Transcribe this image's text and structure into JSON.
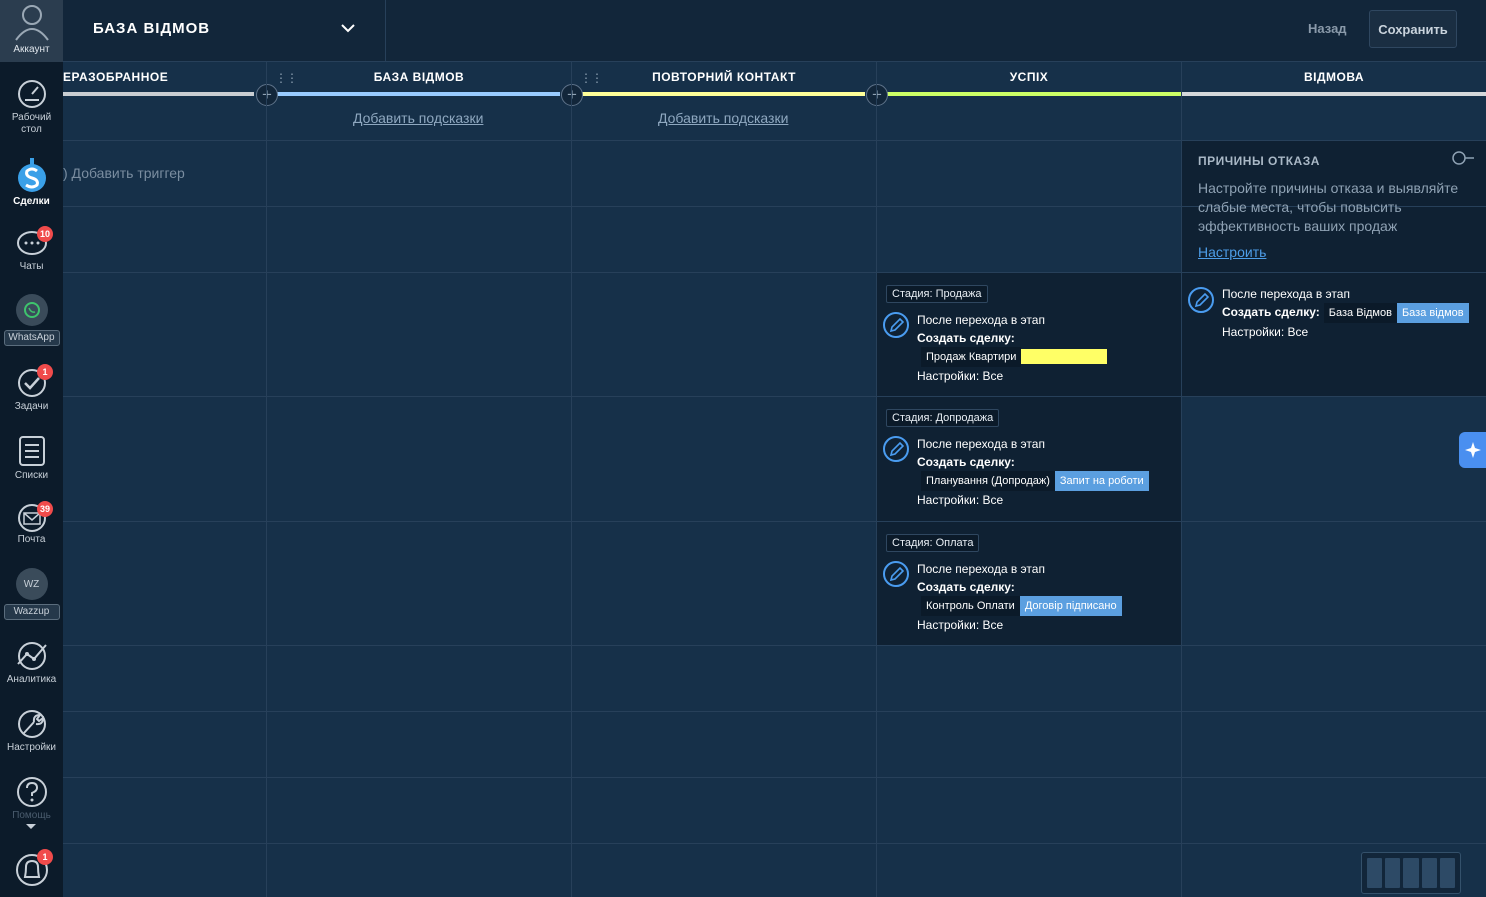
{
  "sidebar": {
    "account_label": "Аккаунт",
    "items": [
      {
        "label": "Рабочий\nстол",
        "icon": "dashboard-icon"
      },
      {
        "label": "Сделки",
        "icon": "deals-icon"
      },
      {
        "label": "Чаты",
        "icon": "chat-icon",
        "badge": "10"
      },
      {
        "label": "WhatsApp",
        "icon": "whatsapp-icon"
      },
      {
        "label": "Задачи",
        "icon": "tasks-icon",
        "badge": "1"
      },
      {
        "label": "Списки",
        "icon": "lists-icon"
      },
      {
        "label": "Почта",
        "icon": "mail-icon",
        "badge": "39"
      },
      {
        "label": "Wazzup",
        "icon": "wazzup-icon",
        "icon_text": "WZ"
      },
      {
        "label": "Аналитика",
        "icon": "analytics-icon"
      },
      {
        "label": "Настройки",
        "icon": "settings-icon"
      },
      {
        "label": "Помощь",
        "icon": "help-icon"
      },
      {
        "label": "",
        "icon": "notifications-icon",
        "badge": "1"
      }
    ]
  },
  "header": {
    "pipeline_title": "БАЗА ВІДМОВ",
    "back_label": "Назад",
    "save_label": "Сохранить"
  },
  "columns": [
    {
      "title": "ЕРАЗОБРАННОЕ",
      "color": "#c9cdd1"
    },
    {
      "title": "БАЗА ВІДМОВ",
      "color": "#99ccff",
      "hint": "Добавить подсказки"
    },
    {
      "title": "ПОВТОРНИЙ КОНТАКТ",
      "color": "#ffff99",
      "hint": "Добавить подсказки"
    },
    {
      "title": "УСПІХ",
      "color": "#ccff66"
    },
    {
      "title": "ВІДМОВА",
      "color": "#d5d8db"
    }
  ],
  "add_trigger_label": ") Добавить триггер",
  "triggers_success": [
    {
      "stage": "Стадия: Продажа",
      "line1": "После перехода в этап",
      "line2": "Создать сделку:",
      "pipeline": "Продаж Квартири",
      "stage_name": "",
      "stage_color": "#ffff66",
      "settings": "Настройки: Все"
    },
    {
      "stage": "Стадия: Допродажа",
      "line1": "После перехода в этап",
      "line2": "Создать сделку:",
      "pipeline": "Планування (Допродаж)",
      "stage_name": "Запит на роботи",
      "stage_color": "#5b9fe0",
      "settings": "Настройки: Все"
    },
    {
      "stage": "Стадия: Оплата",
      "line1": "После перехода в этап",
      "line2": "Создать сделку:",
      "pipeline": "Контроль Оплати",
      "stage_name": "Договір підписано",
      "stage_color": "#5b9fe0",
      "settings": "Настройки: Все"
    }
  ],
  "trigger_refusal": {
    "line1": "После перехода в этап",
    "line2": "Создать сделку:",
    "pipeline": "База Відмов",
    "stage_name": "База відмов",
    "stage_color": "#5b9fe0",
    "settings": "Настройки: Все"
  },
  "loss_reasons": {
    "title": "ПРИЧИНЫ ОТКАЗА",
    "description": "Настройте причины отказа и выявляйте слабые места, чтобы повысить эффективность ваших продаж",
    "link": "Настроить"
  }
}
